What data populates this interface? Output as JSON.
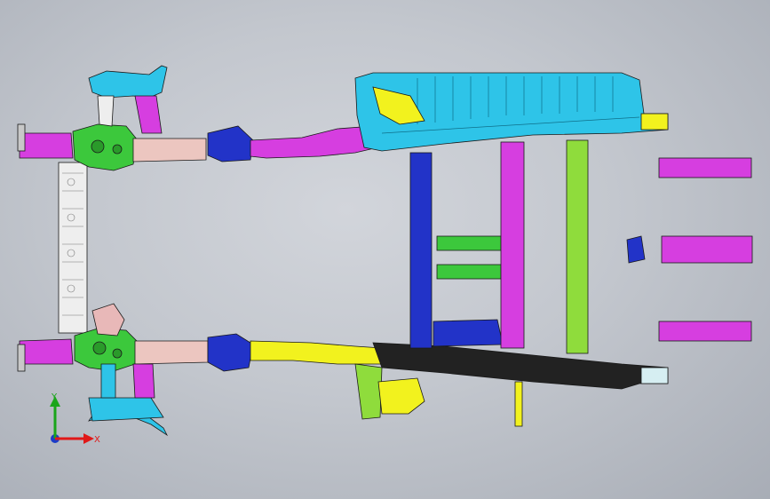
{
  "viewport": {
    "background_gradient": [
      "#d2d5db",
      "#a8adb6"
    ]
  },
  "triad": {
    "y_label": "Y",
    "x_label": "X",
    "y_color": "#1aa51a",
    "x_color": "#e01818",
    "z_color": "#1b3cc8"
  },
  "model": {
    "description_colors": {
      "magenta": "#d63ee0",
      "cyan": "#2ec4e8",
      "blue": "#2233c8",
      "green": "#3cc83c",
      "yellow": "#f2f21e",
      "black": "#222222",
      "white": "#eeeeee",
      "pink": "#e8b8b8",
      "lime": "#8fdc3c"
    }
  }
}
